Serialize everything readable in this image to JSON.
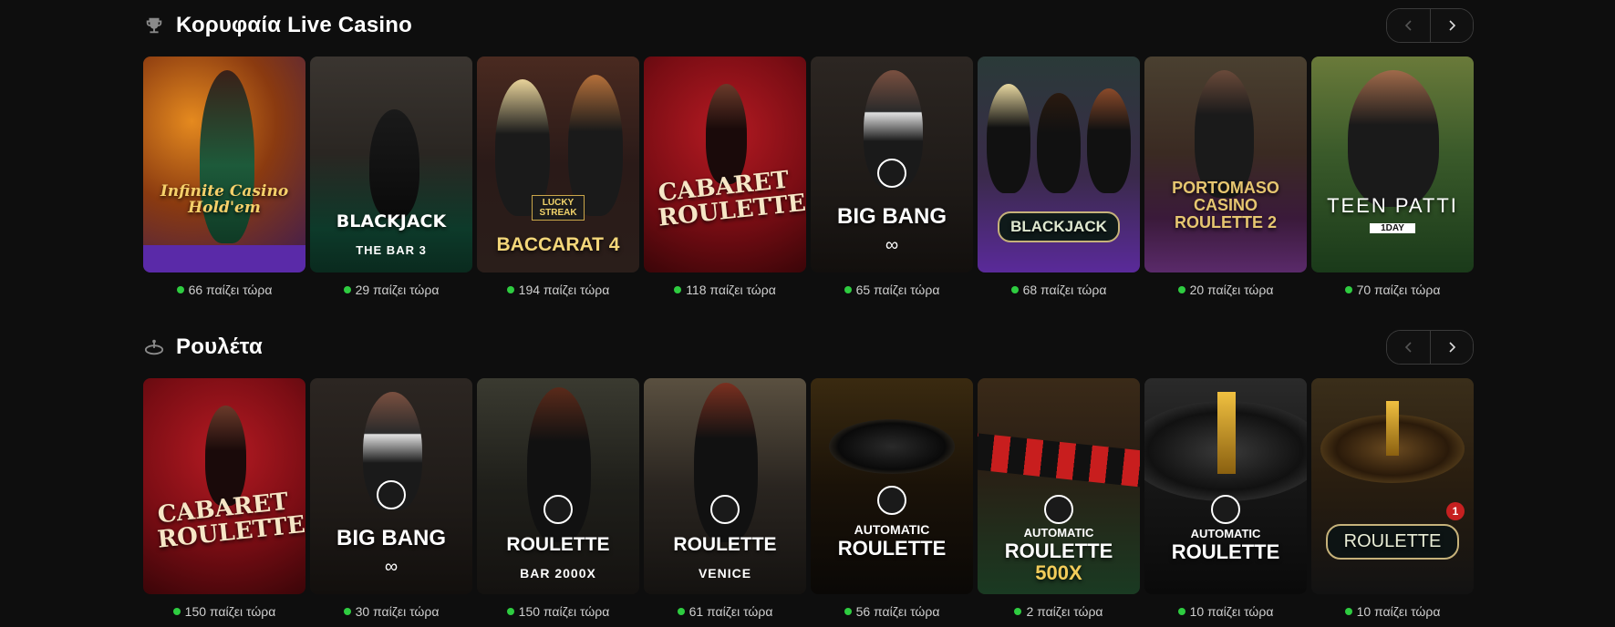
{
  "colors": {
    "background": "#0e0e0e",
    "live_dot": "#2ecc40"
  },
  "sections": [
    {
      "title": "Κορυφαία Live Casino",
      "icon": "trophy-icon",
      "nav": {
        "prev": "chevron-left-icon",
        "next": "chevron-right-icon"
      },
      "games": [
        {
          "name": "Infinite Casino Hold'em",
          "players": "66 παίζει τώρα"
        },
        {
          "name": "BLACKJACK",
          "sub": "THE BAR 3",
          "players": "29 παίζει τώρα"
        },
        {
          "name": "BACCARAT 4",
          "badge": "LUCKY STREAK",
          "players": "194 παίζει τώρα"
        },
        {
          "name": "CABARET ROULETTE",
          "players": "118 παίζει τώρα"
        },
        {
          "name": "BIG BANG",
          "players": "65 παίζει τώρα"
        },
        {
          "name": "BLACKJACK",
          "players": "68 παίζει τώρα"
        },
        {
          "name": "PORTOMASO CASINO ROULETTE 2",
          "players": "20 παίζει τώρα"
        },
        {
          "name": "TEEN PATTI",
          "badge": "1DAY",
          "players": "70 παίζει τώρα"
        }
      ]
    },
    {
      "title": "Ρουλέτα",
      "icon": "roulette-icon",
      "nav": {
        "prev": "chevron-left-icon",
        "next": "chevron-right-icon"
      },
      "games": [
        {
          "name": "CABARET ROULETTE",
          "players": "150 παίζει τώρα"
        },
        {
          "name": "BIG BANG",
          "players": "30 παίζει τώρα"
        },
        {
          "name": "ROULETTE",
          "sub": "BAR 2000X",
          "players": "150 παίζει τώρα"
        },
        {
          "name": "ROULETTE",
          "sub": "VENICE",
          "players": "61 παίζει τώρα"
        },
        {
          "name": "ROULETTE",
          "badge": "AUTOMATIC",
          "players": "56 παίζει τώρα"
        },
        {
          "name": "ROULETTE",
          "badge": "AUTOMATIC",
          "sub": "500X",
          "players": "2 παίζει τώρα"
        },
        {
          "name": "ROULETTE",
          "badge": "AUTOMATIC",
          "players": "10 παίζει τώρα"
        },
        {
          "name": "ROULETTE",
          "badge": "1",
          "players": "10 παίζει τώρα"
        }
      ]
    }
  ]
}
